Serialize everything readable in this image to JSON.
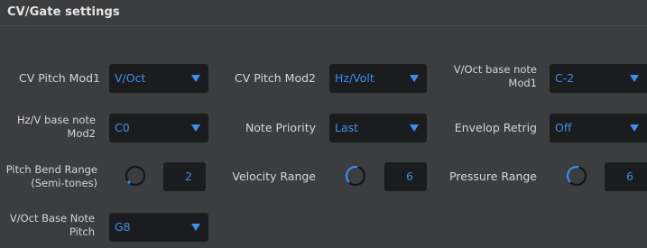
{
  "header": {
    "title": "CV/Gate settings"
  },
  "colors": {
    "accent": "#3d8ef0",
    "background": "#3c3d3f",
    "field": "#1b1c1e",
    "label": "#d6d6d6"
  },
  "rows": {
    "cv_pitch_mod1": {
      "label": "CV Pitch Mod1",
      "value": "V/Oct"
    },
    "cv_pitch_mod2": {
      "label": "CV Pitch Mod2",
      "value": "Hz/Volt"
    },
    "voct_base_note_mod1": {
      "label_line1": "V/Oct base note",
      "label_line2": "Mod1",
      "value": "C-2"
    },
    "hzv_base_note_mod2": {
      "label_line1": "Hz/V base note",
      "label_line2": "Mod2",
      "value": "C0"
    },
    "note_priority": {
      "label": "Note Priority",
      "value": "Last"
    },
    "envelop_retrig": {
      "label": "Envelop Retrig",
      "value": "Off"
    },
    "pitch_bend_range": {
      "label_line1": "Pitch Bend Range",
      "label_line2": "(Semi-tones)",
      "value": "2",
      "knob_level": 0.0
    },
    "velocity_range": {
      "label": "Velocity Range",
      "value": "6",
      "knob_level": 0.55
    },
    "pressure_range": {
      "label": "Pressure Range",
      "value": "6",
      "knob_level": 0.55
    },
    "voct_base_note_pitch": {
      "label_line1": "V/Oct Base Note",
      "label_line2": "Pitch",
      "value": "G8"
    }
  },
  "icons": {
    "dropdown": "chevron-down-icon",
    "knob": "rotary-knob-icon"
  }
}
